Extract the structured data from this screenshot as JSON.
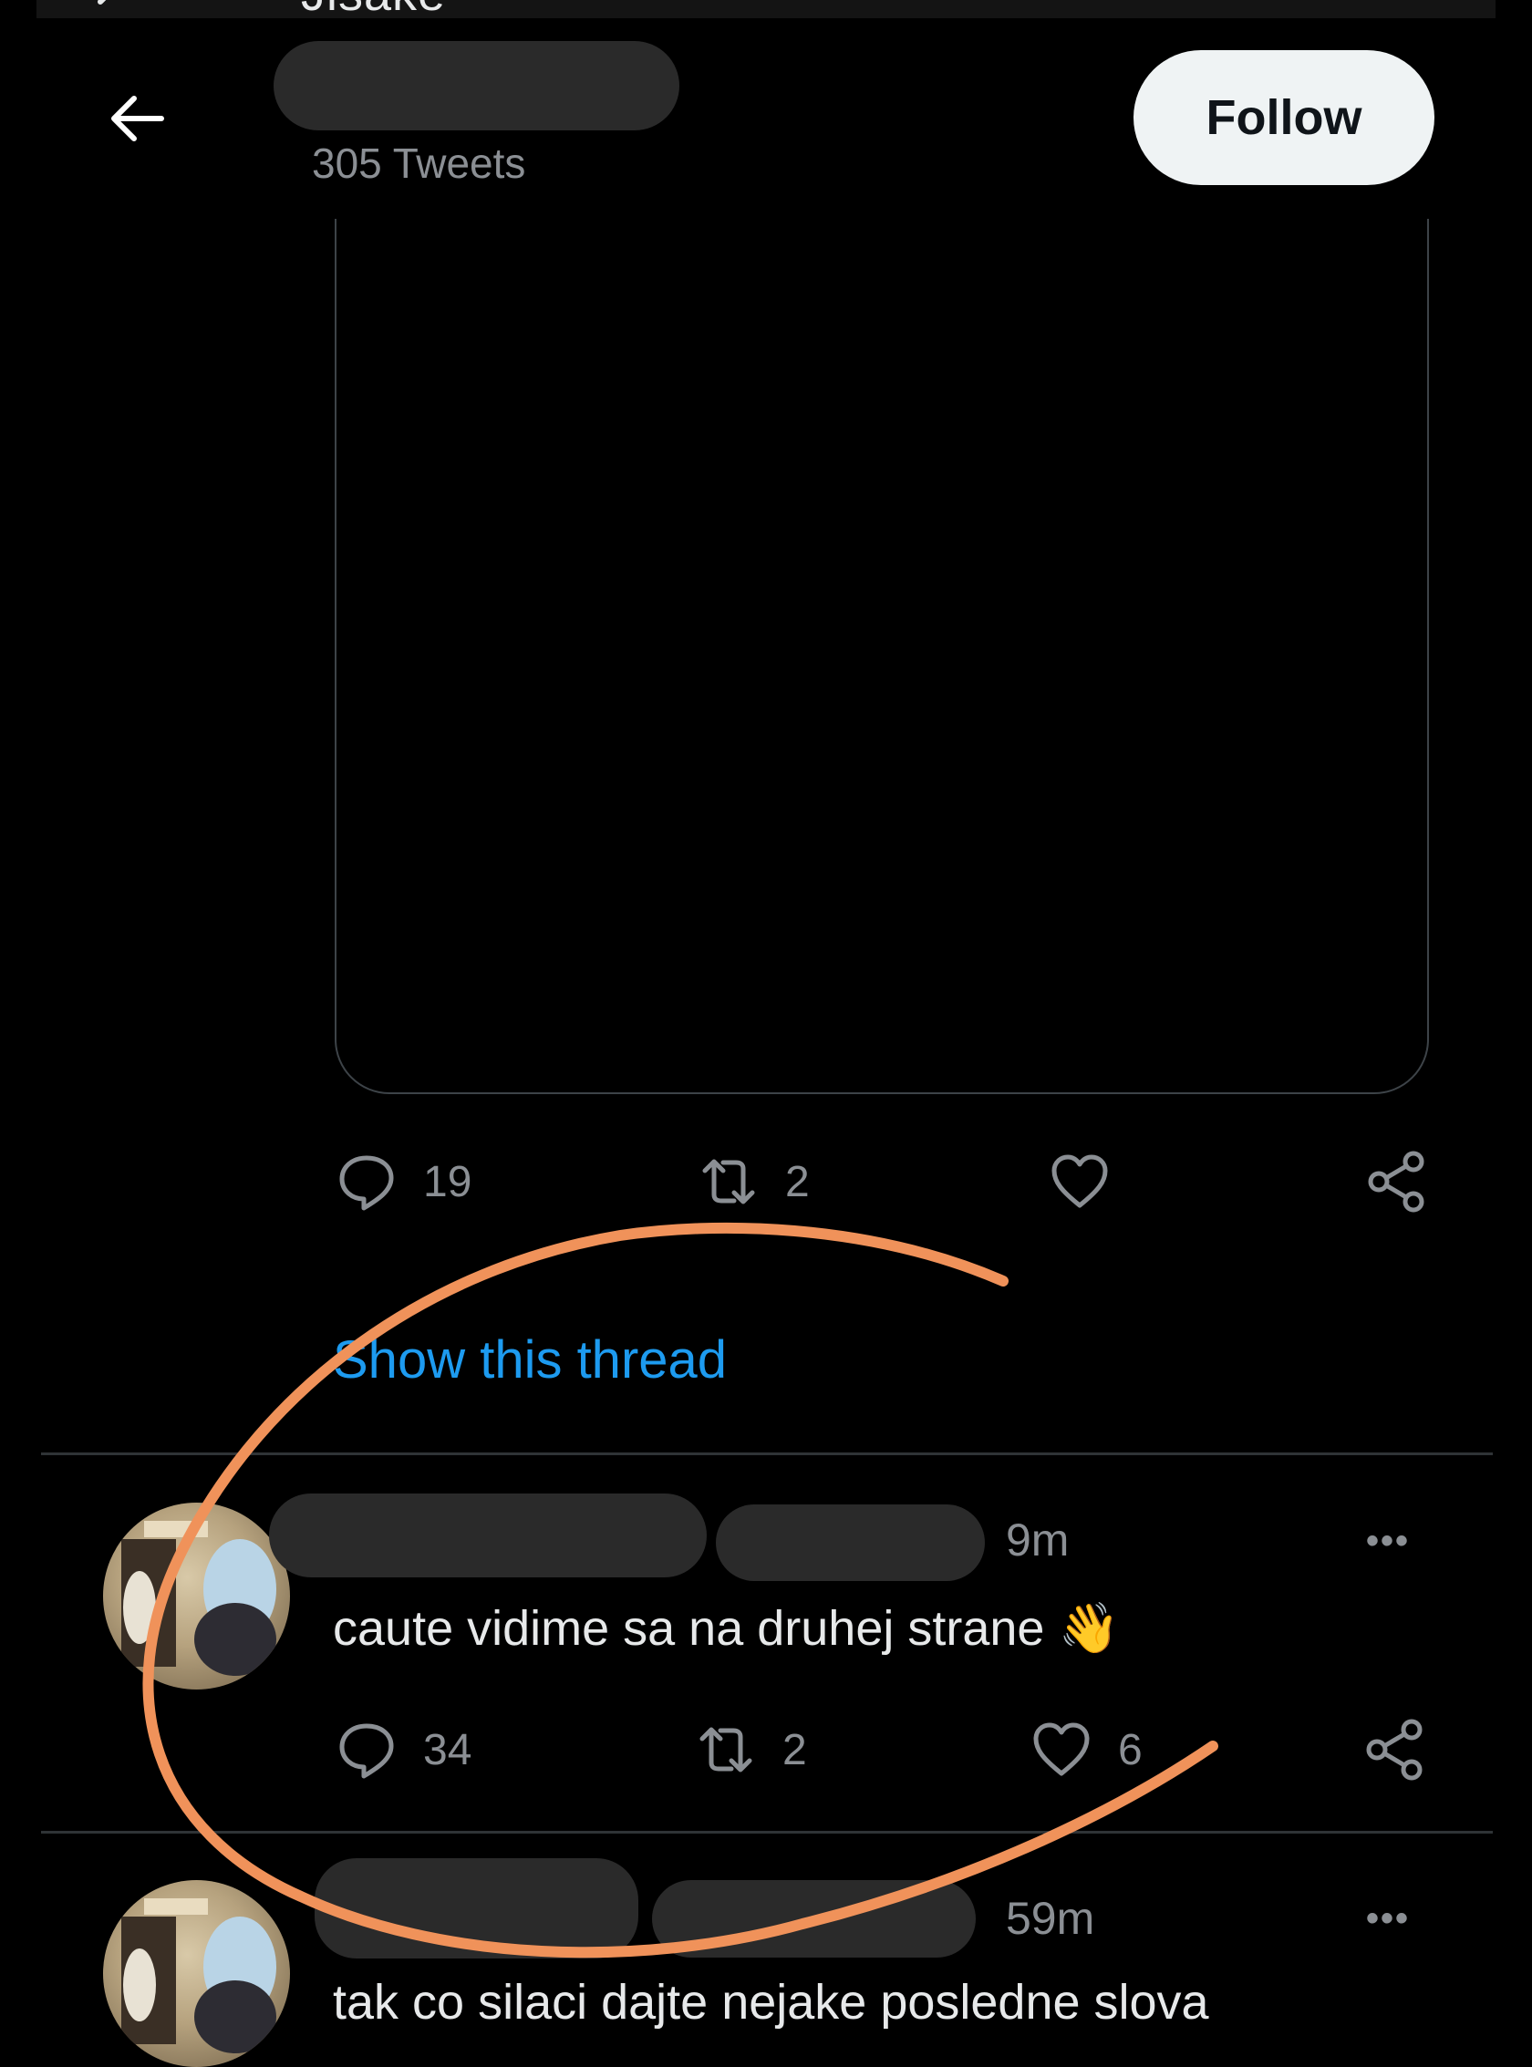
{
  "header": {
    "title_partial": "Jisake",
    "tweet_count": "305 Tweets",
    "follow_label": "Follow"
  },
  "tweet": {
    "replies": "19",
    "retweets": "2",
    "likes": "",
    "show_thread": "Show this thread"
  },
  "replies": [
    {
      "time": "9m",
      "text": "caute vidime sa na druhej strane 👋",
      "replies": "34",
      "retweets": "2",
      "likes": "6"
    },
    {
      "time": "59m",
      "text": "tak co silaci dajte nejake posledne slova"
    }
  ],
  "icons": {
    "back": "arrow-left-icon",
    "reply": "speech-bubble-icon",
    "retweet": "retweet-icon",
    "like": "heart-icon",
    "share": "share-icon",
    "more": "more-dots-icon"
  },
  "colors": {
    "background": "#000000",
    "accent_link": "#1d9bf0",
    "annotation": "#f0925a",
    "muted_text": "#8b8f94"
  }
}
